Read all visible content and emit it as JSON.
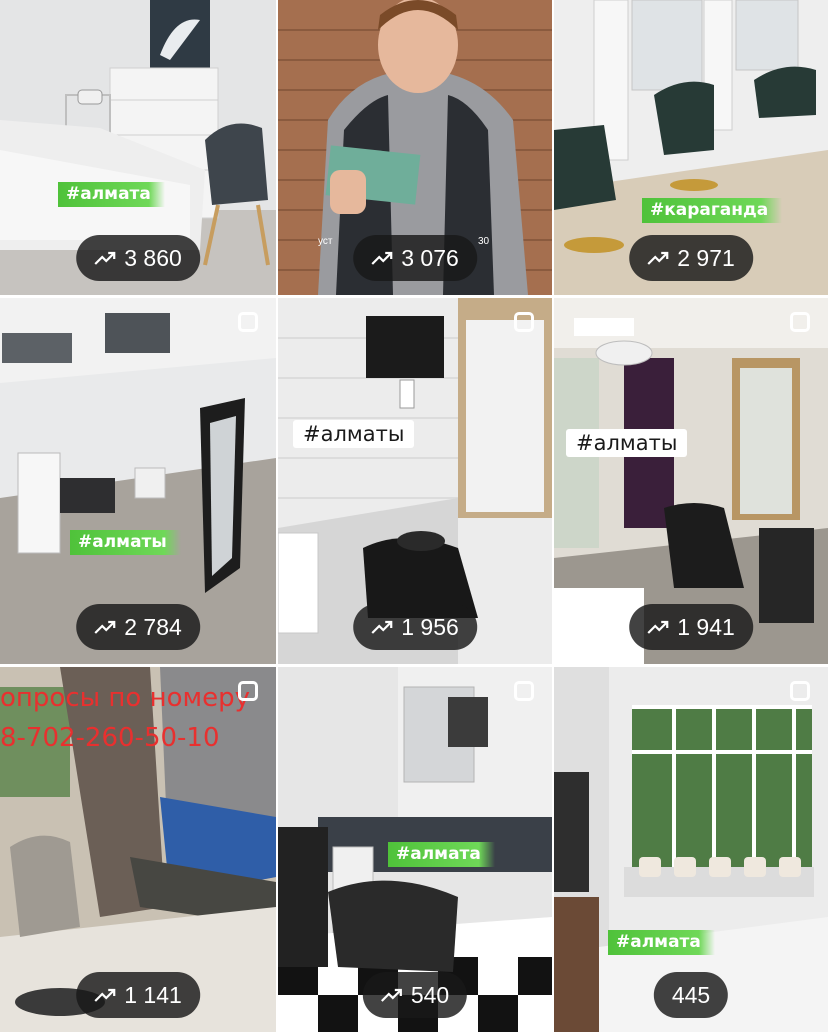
{
  "grid": {
    "tiles": [
      {
        "tag": "#алмата",
        "tag_style": "green",
        "views": "3 860",
        "multi": false
      },
      {
        "tag": "",
        "views": "3 076",
        "multi": false,
        "caption": "уст",
        "caption_right": "30"
      },
      {
        "tag": "#караганда",
        "tag_style": "green",
        "views": "2 971",
        "multi": false
      },
      {
        "tag": "#алматы",
        "tag_style": "green",
        "views": "2 784",
        "multi": true
      },
      {
        "tag": "#алматы",
        "tag_style": "white",
        "views": "1 956",
        "multi": true
      },
      {
        "tag": "#алматы",
        "tag_style": "white",
        "views": "1 941",
        "multi": true
      },
      {
        "tag": "",
        "views": "1 141",
        "multi": true,
        "overlay_line1": "опросы по номеру",
        "overlay_line2": "8-702-260-50-10"
      },
      {
        "tag": "#алмата",
        "tag_style": "green",
        "views": "540",
        "multi": true
      },
      {
        "tag": "#алмата",
        "tag_style": "green",
        "views": "445",
        "multi": true,
        "show_trend": false
      }
    ]
  },
  "icons": {
    "trend": "trending-up-icon",
    "multi": "multiple-photos-icon"
  },
  "colors": {
    "pill_bg": "#181818",
    "tag_green": "#4fc23a",
    "overlay_red": "#e8302f"
  }
}
